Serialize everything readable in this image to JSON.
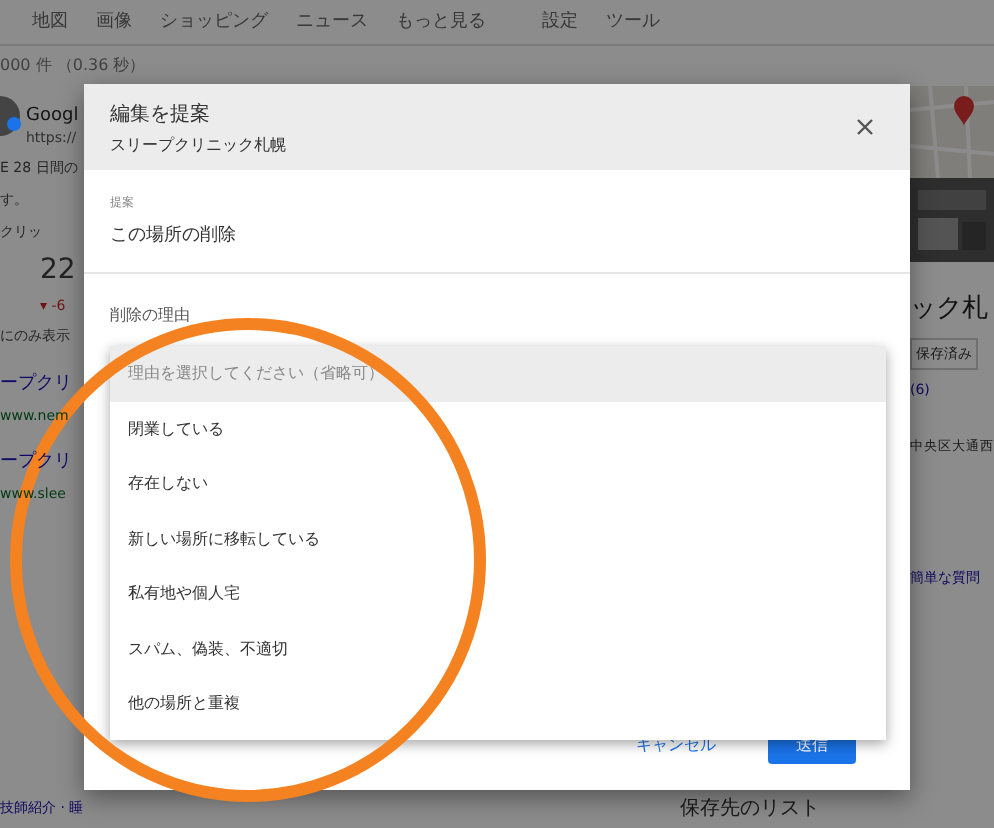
{
  "nav_tabs": [
    {
      "label": "地図",
      "selected": false
    },
    {
      "label": "画像",
      "selected": false
    },
    {
      "label": "ショッピング",
      "selected": false
    },
    {
      "label": "ニュース",
      "selected": false
    },
    {
      "label": "もっと見る",
      "selected": false
    },
    {
      "label": "設定",
      "selected": false
    },
    {
      "label": "ツール",
      "selected": false
    }
  ],
  "results_count": "000 件 （0.36 秒）",
  "avatar_title": "Googl",
  "left_results": [
    {
      "kind": "url",
      "text": "https://"
    },
    {
      "kind": "text",
      "text": "E 28 日間の"
    },
    {
      "kind": "text",
      "text": "す。"
    },
    {
      "kind": "text",
      "text": "クリッ"
    },
    {
      "kind": "stat",
      "text": "22"
    },
    {
      "kind": "change",
      "text": "▾ -6"
    },
    {
      "kind": "text",
      "text": "にのみ表示"
    },
    {
      "kind": "link",
      "text": "ープクリ"
    },
    {
      "kind": "url",
      "text": "www.nem"
    },
    {
      "kind": "link",
      "text": "ープクリ"
    },
    {
      "kind": "url",
      "text": "www.slee"
    }
  ],
  "right_panel": {
    "title": "ック札",
    "saved_button": "保存済み",
    "review_count": "(6)",
    "address": "中央区大通西",
    "question_link": "簡単な質問"
  },
  "bottom_left": "技師紹介 · 睡",
  "saved_lists": "保存先のリスト",
  "dialog": {
    "title": "編集を提案",
    "subtitle": "スリープクリニック札幌",
    "field_label": "提案",
    "field_value": "この場所の削除",
    "reason_label": "削除の理由",
    "options": [
      {
        "label": "理由を選択してください（省略可）",
        "selected": true
      },
      {
        "label": "閉業している",
        "selected": false
      },
      {
        "label": "存在しない",
        "selected": false
      },
      {
        "label": "新しい場所に移転している",
        "selected": false
      },
      {
        "label": "私有地や個人宅",
        "selected": false
      },
      {
        "label": "スパム、偽装、不適切",
        "selected": false
      },
      {
        "label": "他の場所と重複",
        "selected": false
      }
    ],
    "buttons": [
      {
        "kind": "text",
        "label": "キャンセル"
      },
      {
        "kind": "primary",
        "label": "送信"
      }
    ]
  }
}
